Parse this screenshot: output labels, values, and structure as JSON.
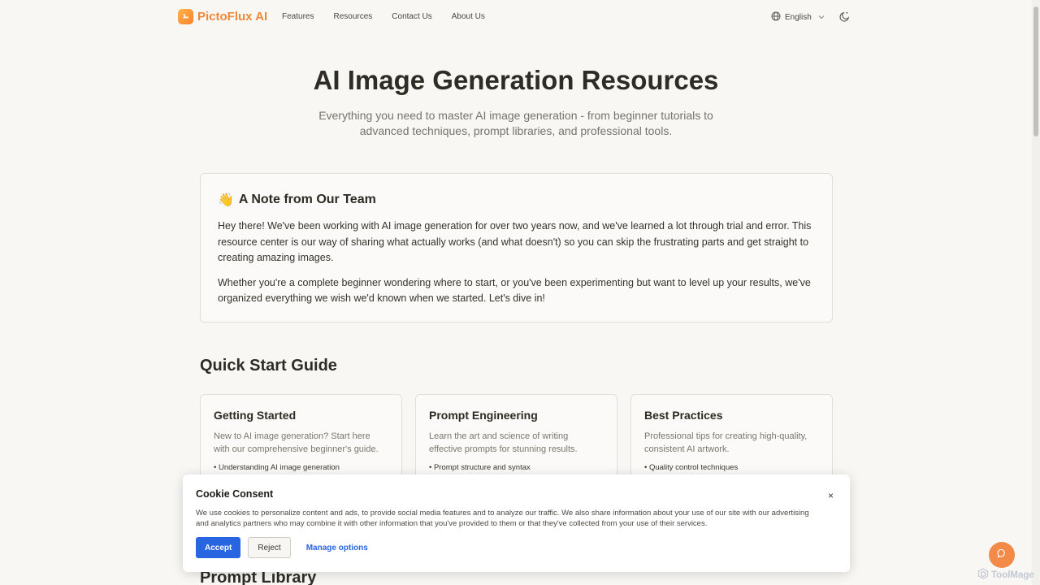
{
  "header": {
    "brand": "PictoFlux AI",
    "nav": [
      "Features",
      "Resources",
      "Contact Us",
      "About Us"
    ],
    "language": "English"
  },
  "hero": {
    "title": "AI Image Generation Resources",
    "subtitle": "Everything you need to master AI image generation - from beginner tutorials to advanced techniques, prompt libraries, and professional tools."
  },
  "note": {
    "emoji": "👋",
    "title": "A Note from Our Team",
    "paragraphs": [
      "Hey there! We've been working with AI image generation for over two years now, and we've learned a lot through trial and error. This resource center is our way of sharing what actually works (and what doesn't) so you can skip the frustrating parts and get straight to creating amazing images.",
      "Whether you're a complete beginner wondering where to start, or you've been experimenting but want to level up your results, we've organized everything we wish we'd known when we started. Let's dive in!"
    ]
  },
  "quick_start": {
    "title": "Quick Start Guide",
    "cards": [
      {
        "title": "Getting Started",
        "desc": "New to AI image generation? Start here with our comprehensive beginner's guide.",
        "bullet": "• Understanding AI image generation"
      },
      {
        "title": "Prompt Engineering",
        "desc": "Learn the art and science of writing effective prompts for stunning results.",
        "bullet": "• Prompt structure and syntax"
      },
      {
        "title": "Best Practices",
        "desc": "Professional tips for creating high-quality, consistent AI artwork.",
        "bullet": "• Quality control techniques"
      }
    ]
  },
  "prompt_library": {
    "title": "Prompt Library"
  },
  "cookie": {
    "title": "Cookie Consent",
    "text": "We use cookies to personalize content and ads, to provide social media features and to analyze our traffic. We also share information about your use of our site with our advertising and analytics partners who may combine it with other information that you've provided to them or that they've collected from your use of their services.",
    "accept": "Accept",
    "reject": "Reject",
    "manage": "Manage options",
    "close": "×"
  },
  "watermark": "ToolMage",
  "colors": {
    "brand": "#f0883a",
    "accent_blue": "#2865e0",
    "chat_fab": "#f48a48",
    "background": "#f8f7f4"
  },
  "icons": {
    "logo": "brand-logo-icon",
    "globe": "globe-icon",
    "chevron": "chevron-down-icon",
    "theme": "moon-icon",
    "chat": "chat-icon",
    "close": "close-icon"
  }
}
